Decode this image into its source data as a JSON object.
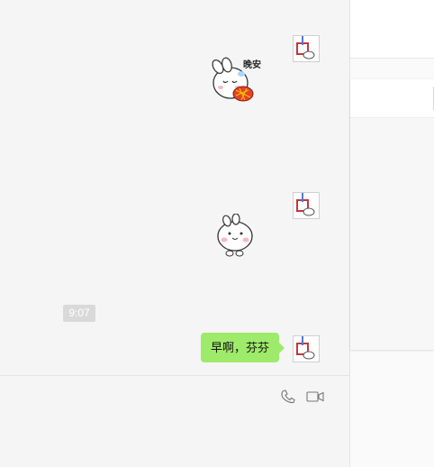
{
  "chat": {
    "messages": [
      {
        "type": "sticker",
        "sender": "self",
        "sticker_text": "晚安"
      },
      {
        "type": "sticker",
        "sender": "self"
      },
      {
        "type": "timestamp",
        "text": "9:07"
      },
      {
        "type": "text",
        "sender": "self",
        "text": "早啊，芬芬"
      }
    ],
    "toolbar": {
      "icons": [
        "phone-icon",
        "video-call-icon"
      ]
    }
  },
  "colors": {
    "bubble_self": "#9eea6a",
    "chat_bg": "#f5f5f5",
    "timestamp_bg": "#d9d9d9"
  }
}
